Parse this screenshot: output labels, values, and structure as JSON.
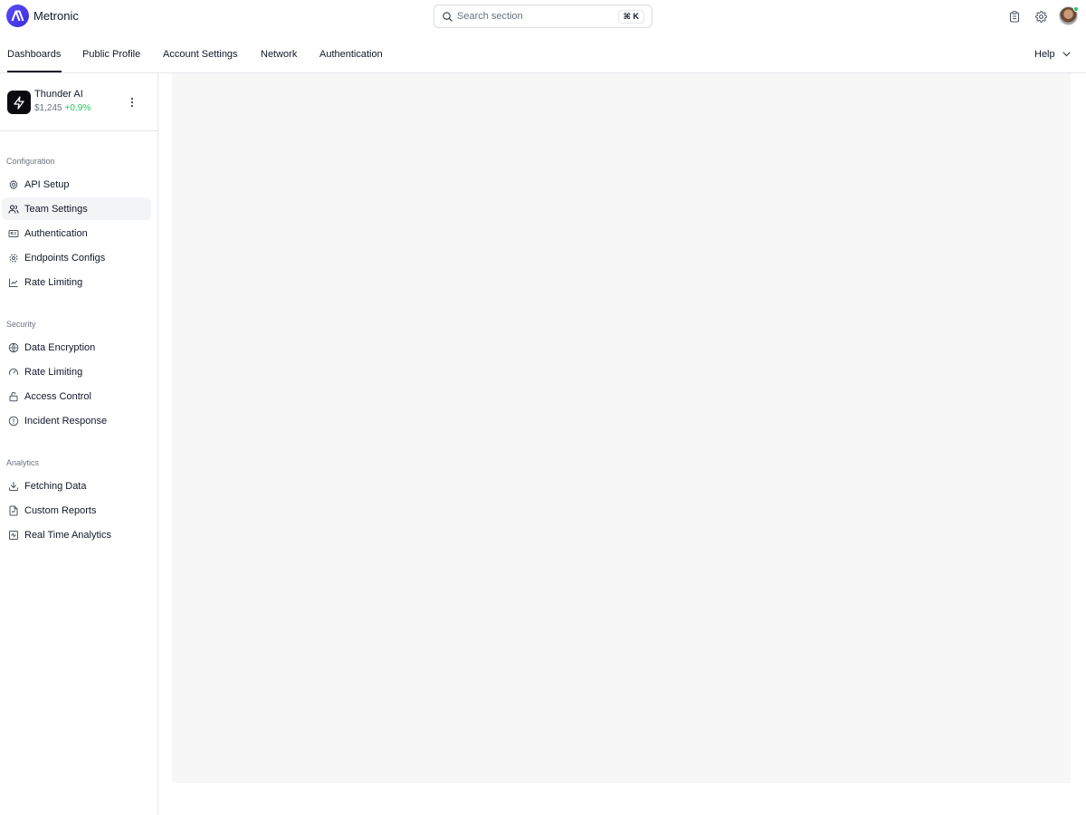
{
  "brand": {
    "name": "Metronic"
  },
  "search": {
    "placeholder": "Search section",
    "shortcut": "⌘ K"
  },
  "header_icons": [
    "clipboard-icon",
    "gear-icon"
  ],
  "nav": {
    "tabs": [
      {
        "label": "Dashboards",
        "active": true
      },
      {
        "label": "Public Profile"
      },
      {
        "label": "Account Settings"
      },
      {
        "label": "Network"
      },
      {
        "label": "Authentication"
      }
    ],
    "help_label": "Help"
  },
  "account": {
    "name": "Thunder AI",
    "balance": "$1,245",
    "change": "+0.9%",
    "change_color": "#22c55e"
  },
  "sidebar": {
    "sections": [
      {
        "title": "Configuration",
        "items": [
          {
            "label": "API Setup",
            "icon": "gear-icon"
          },
          {
            "label": "Team Settings",
            "icon": "users-icon",
            "active": true
          },
          {
            "label": "Authentication",
            "icon": "id-card-icon"
          },
          {
            "label": "Endpoints Configs",
            "icon": "settings-cog-icon"
          },
          {
            "label": "Rate Limiting",
            "icon": "line-chart-icon"
          }
        ]
      },
      {
        "title": "Security",
        "items": [
          {
            "label": "Data Encryption",
            "icon": "globe-icon"
          },
          {
            "label": "Rate Limiting",
            "icon": "gauge-icon"
          },
          {
            "label": "Access Control",
            "icon": "lock-icon"
          },
          {
            "label": "Incident Response",
            "icon": "info-circle-icon"
          }
        ]
      },
      {
        "title": "Analytics",
        "items": [
          {
            "label": "Fetching Data",
            "icon": "download-icon"
          },
          {
            "label": "Custom Reports",
            "icon": "file-report-icon"
          },
          {
            "label": "Real Time Analytics",
            "icon": "activity-icon"
          }
        ]
      }
    ]
  }
}
